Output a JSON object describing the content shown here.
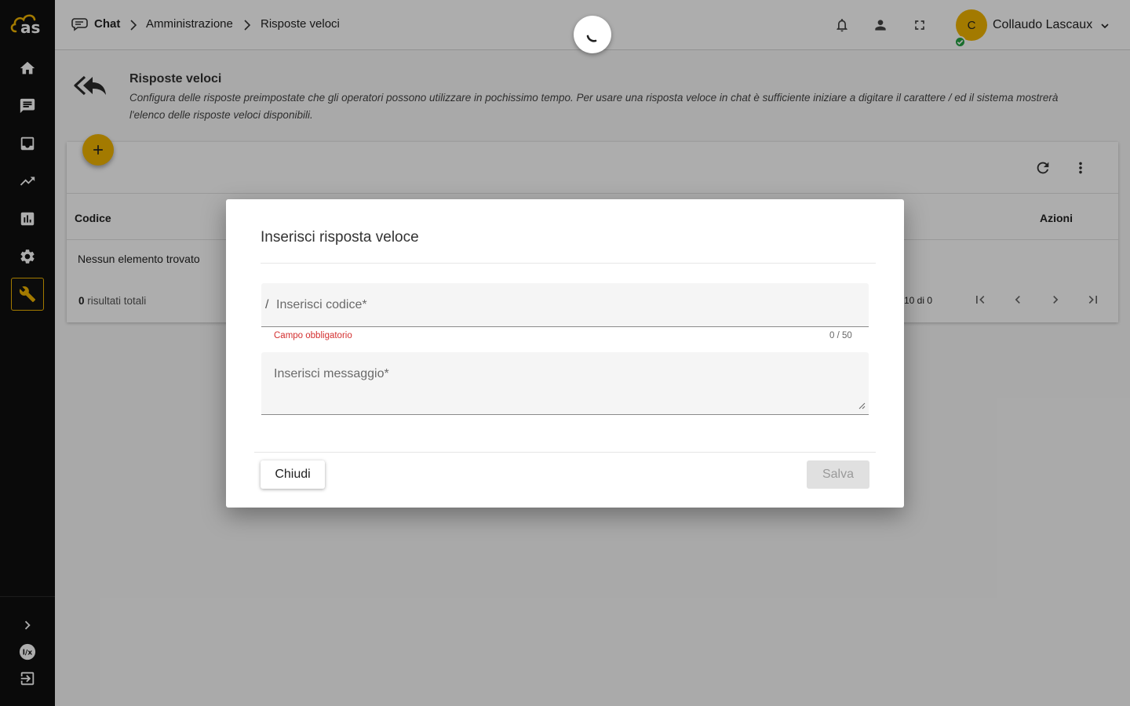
{
  "app": {
    "logo_text": "as",
    "brand_color": "#f0b400"
  },
  "breadcrumb": {
    "items": [
      "Chat",
      "Amministrazione",
      "Risposte veloci"
    ]
  },
  "user": {
    "avatar_letter": "C",
    "name": "Collaudo Lascaux",
    "status": "online"
  },
  "page": {
    "title": "Risposte veloci",
    "description": "Configura delle risposte preimpostate che gli operatori possono utilizzare in pochissimo tempo. Per usare una risposta veloce in chat è sufficiente iniziare a digitare il carattere / ed il sistema mostrerà l'elenco delle risposte veloci disponibili."
  },
  "table": {
    "columns": [
      "Codice",
      "Azioni"
    ],
    "empty_message": "Nessun elemento trovato",
    "total_count": "0",
    "total_label": " risultati totali",
    "range": "10 di 0"
  },
  "dialog": {
    "title": "Inserisci risposta veloce",
    "code_prefix": "/",
    "code_placeholder": "Inserisci codice*",
    "code_error": "Campo obbligatorio",
    "code_counter": "0 / 50",
    "message_placeholder": "Inserisci messaggio*",
    "close_label": "Chiudi",
    "save_label": "Salva"
  },
  "icons": {
    "sidebar": [
      "home-icon",
      "chat-icon",
      "inbox-icon",
      "trending-icon",
      "bar-chart-icon",
      "settings-icon",
      "wrench-icon",
      "expand-icon",
      "lx-icon",
      "logout-icon"
    ],
    "topbar": [
      "bell-icon",
      "person-icon",
      "fullscreen-icon"
    ]
  }
}
